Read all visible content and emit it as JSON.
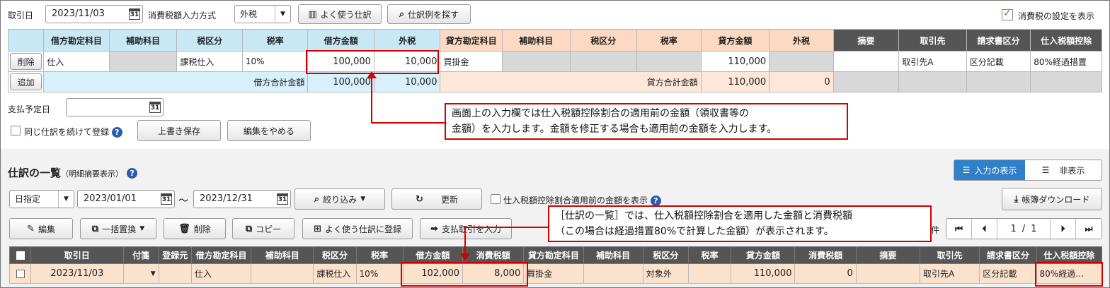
{
  "form": {
    "date_label": "取引日",
    "date_value": "2023/11/03",
    "tax_input_label": "消費税額入力方式",
    "tax_input_value": "外税",
    "fav_button": "よく使う仕訳",
    "example_button": "仕訳例を探す",
    "show_tax_label": "消費税の設定を表示"
  },
  "entry_table": {
    "headers": [
      "借方勘定科目",
      "補助科目",
      "税区分",
      "税率",
      "借方金額",
      "外税",
      "貸方勘定科目",
      "補助科目",
      "税区分",
      "税率",
      "貸方金額",
      "外税",
      "摘要",
      "取引先",
      "請求書区分",
      "仕入税額控除"
    ],
    "row": {
      "delete": "削除",
      "debit_account": "仕入",
      "debit_tax_class": "課税仕入",
      "debit_rate": "10%",
      "debit_amount": "100,000",
      "debit_ext_tax": "10,000",
      "credit_account": "買掛金",
      "credit_amount": "110,000",
      "partner": "取引先A",
      "invoice_class": "区分記載",
      "deduction": "80%経過措置"
    },
    "total": {
      "add": "追加",
      "debit_total_label": "借方合計金額",
      "debit_total": "100,000",
      "debit_ext_total": "10,000",
      "credit_total_label": "貸方合計金額",
      "credit_total": "110,000",
      "credit_ext_total": "0"
    }
  },
  "payment": {
    "label": "支払予定日",
    "continue_label": "同じ仕訳を続けて登録",
    "save_button": "上書き保存",
    "cancel_button": "編集をやめる"
  },
  "callout1": {
    "line1": "画面上の入力欄では仕入税額控除割合の適用前の金額（領収書等の",
    "line2": "金額）を入力します。金額を修正する場合も適用前の金額を入力します。"
  },
  "list": {
    "title": "仕訳の一覧",
    "subtitle": "（明細摘要表示）",
    "show_input_button": "入力の表示",
    "hide_button": "非表示",
    "date_mode": "日指定",
    "from_date": "2023/01/01",
    "tilde": "～",
    "to_date": "2023/12/31",
    "filter_button": "絞り込み",
    "refresh_button": "更新",
    "pre_amount_label": "仕入税額控除割合適用前の金額を表示",
    "download_button": "帳簿ダウンロード",
    "edit_button": "編集",
    "bulk_replace_button": "一括置換",
    "delete_button": "削除",
    "copy_button": "コピー",
    "register_fav_button": "よく使う仕訳に登録",
    "payment_button": "支払取引を入力",
    "count_suffix": "件",
    "page": "1",
    "page_sep": "/",
    "page_total": "1"
  },
  "callout2": {
    "line1": "［仕訳の一覧］では、仕入税額控除割合を適用した金額と消費税額",
    "line2": "（この場合は経過措置80%で計算した金額）が表示されます。"
  },
  "list_table": {
    "headers": [
      "取引日",
      "付箋",
      "登録元",
      "借方勘定科目",
      "補助科目",
      "税区分",
      "税率",
      "借方金額",
      "消費税額",
      "貸方勘定科目",
      "補助科目",
      "税区分",
      "税率",
      "貸方金額",
      "消費税額",
      "摘要",
      "取引先",
      "請求書区分",
      "仕入税額控除"
    ],
    "row": {
      "date": "2023/11/03",
      "debit_account": "仕入",
      "debit_tax_class": "課税仕入",
      "debit_rate": "10%",
      "debit_amount": "102,000",
      "debit_tax": "8,000",
      "credit_account": "買掛金",
      "credit_tax_class": "対象外",
      "credit_amount": "110,000",
      "credit_tax": "0",
      "partner": "取引先A",
      "invoice_class": "区分記載",
      "deduction": "80%経過…"
    }
  },
  "colors": {
    "accent": "#d40000",
    "header_blue": "#c9e8f6",
    "header_orange": "#fbd9c2",
    "header_dark": "#555555",
    "row_highlight": "#fbe2cd"
  }
}
